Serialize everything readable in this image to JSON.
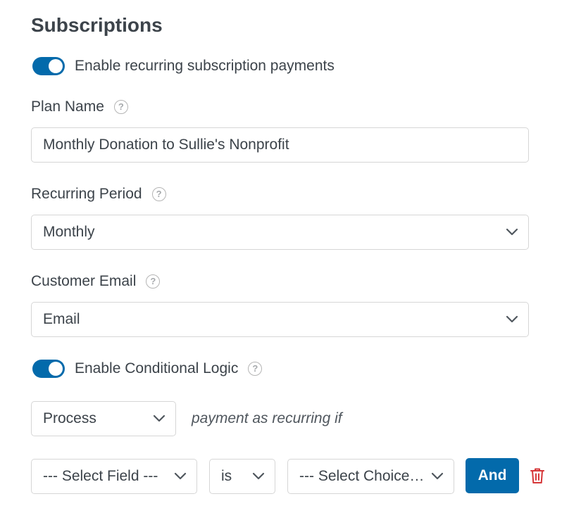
{
  "title": "Subscriptions",
  "recurring_toggle": {
    "label": "Enable recurring subscription payments",
    "on": true
  },
  "plan_name": {
    "label": "Plan Name",
    "help_glyph": "?",
    "value": "Monthly Donation to Sullie's Nonprofit"
  },
  "recurring_period": {
    "label": "Recurring Period",
    "help_glyph": "?",
    "value": "Monthly"
  },
  "customer_email": {
    "label": "Customer Email",
    "help_glyph": "?",
    "value": "Email"
  },
  "conditional_toggle": {
    "label": "Enable Conditional Logic",
    "help_glyph": "?",
    "on": true
  },
  "condition": {
    "action_value": "Process",
    "connector_text": "payment as recurring if",
    "field_value": "--- Select Field ---",
    "operator_value": "is",
    "choice_value": "--- Select Choice ---",
    "and_label": "And"
  },
  "colors": {
    "accent": "#036aab",
    "delete": "#d63638",
    "text": "#3c434a",
    "border": "#d6d6d6"
  },
  "icons": {
    "help": "question-circle-icon",
    "dropdown": "chevron-down-icon",
    "delete": "trash-icon"
  }
}
